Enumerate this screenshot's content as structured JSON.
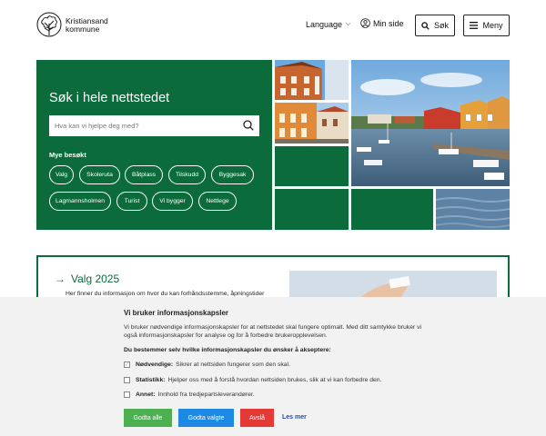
{
  "header": {
    "logo_line1": "Kristiansand",
    "logo_line2": "kommune",
    "language_label": "Language",
    "mypage_label": "Min side",
    "search_label": "Søk",
    "menu_label": "Meny"
  },
  "hero": {
    "title": "Søk i hele nettstedet",
    "search_placeholder": "Hva kan vi hjelpe deg med?",
    "popular_label": "Mye besøkt",
    "links": [
      "Valg",
      "Skoleruta",
      "Båtplass",
      "Tilskudd",
      "Byggesak",
      "Lagmannsholmen",
      "Turist",
      "Vi bygger",
      "Nettlege"
    ]
  },
  "valg": {
    "title": "Valg 2025",
    "description": "Her finner du informasjon om hvor du kan forhåndsstemme, åpningstider"
  },
  "cookie": {
    "title": "Vi bruker informasjonskapsler",
    "text": "Vi bruker nødvendige informasjonskapsler for at nettstedet skal fungere optimalt. Med ditt samtykke bruker vi også informasjonskapsler for analyse og for å forbedre brukeropplevelsen.",
    "choose": "Du bestemmer selv hvilke informasjonskapsler du ønsker å akseptere:",
    "options": [
      {
        "label": "Nødvendige:",
        "text": "Sikrer at nettsiden fungerer som den skal."
      },
      {
        "label": "Statistikk:",
        "text": "Hjelper oss med å forstå hvordan nettsiden brukes, slik at vi kan forbedre den."
      },
      {
        "label": "Annet:",
        "text": "Innhold fra tredjepartsleverandører."
      }
    ],
    "accept_all": "Godta alle",
    "accept_selected": "Godta valgte",
    "reject": "Avslå",
    "read_more": "Les mer"
  },
  "colors": {
    "brand_green": "#0b6b3a",
    "accept_all": "#4caf50",
    "accept_selected": "#1e88e5",
    "reject": "#e53935",
    "link": "#1a4fb4"
  }
}
